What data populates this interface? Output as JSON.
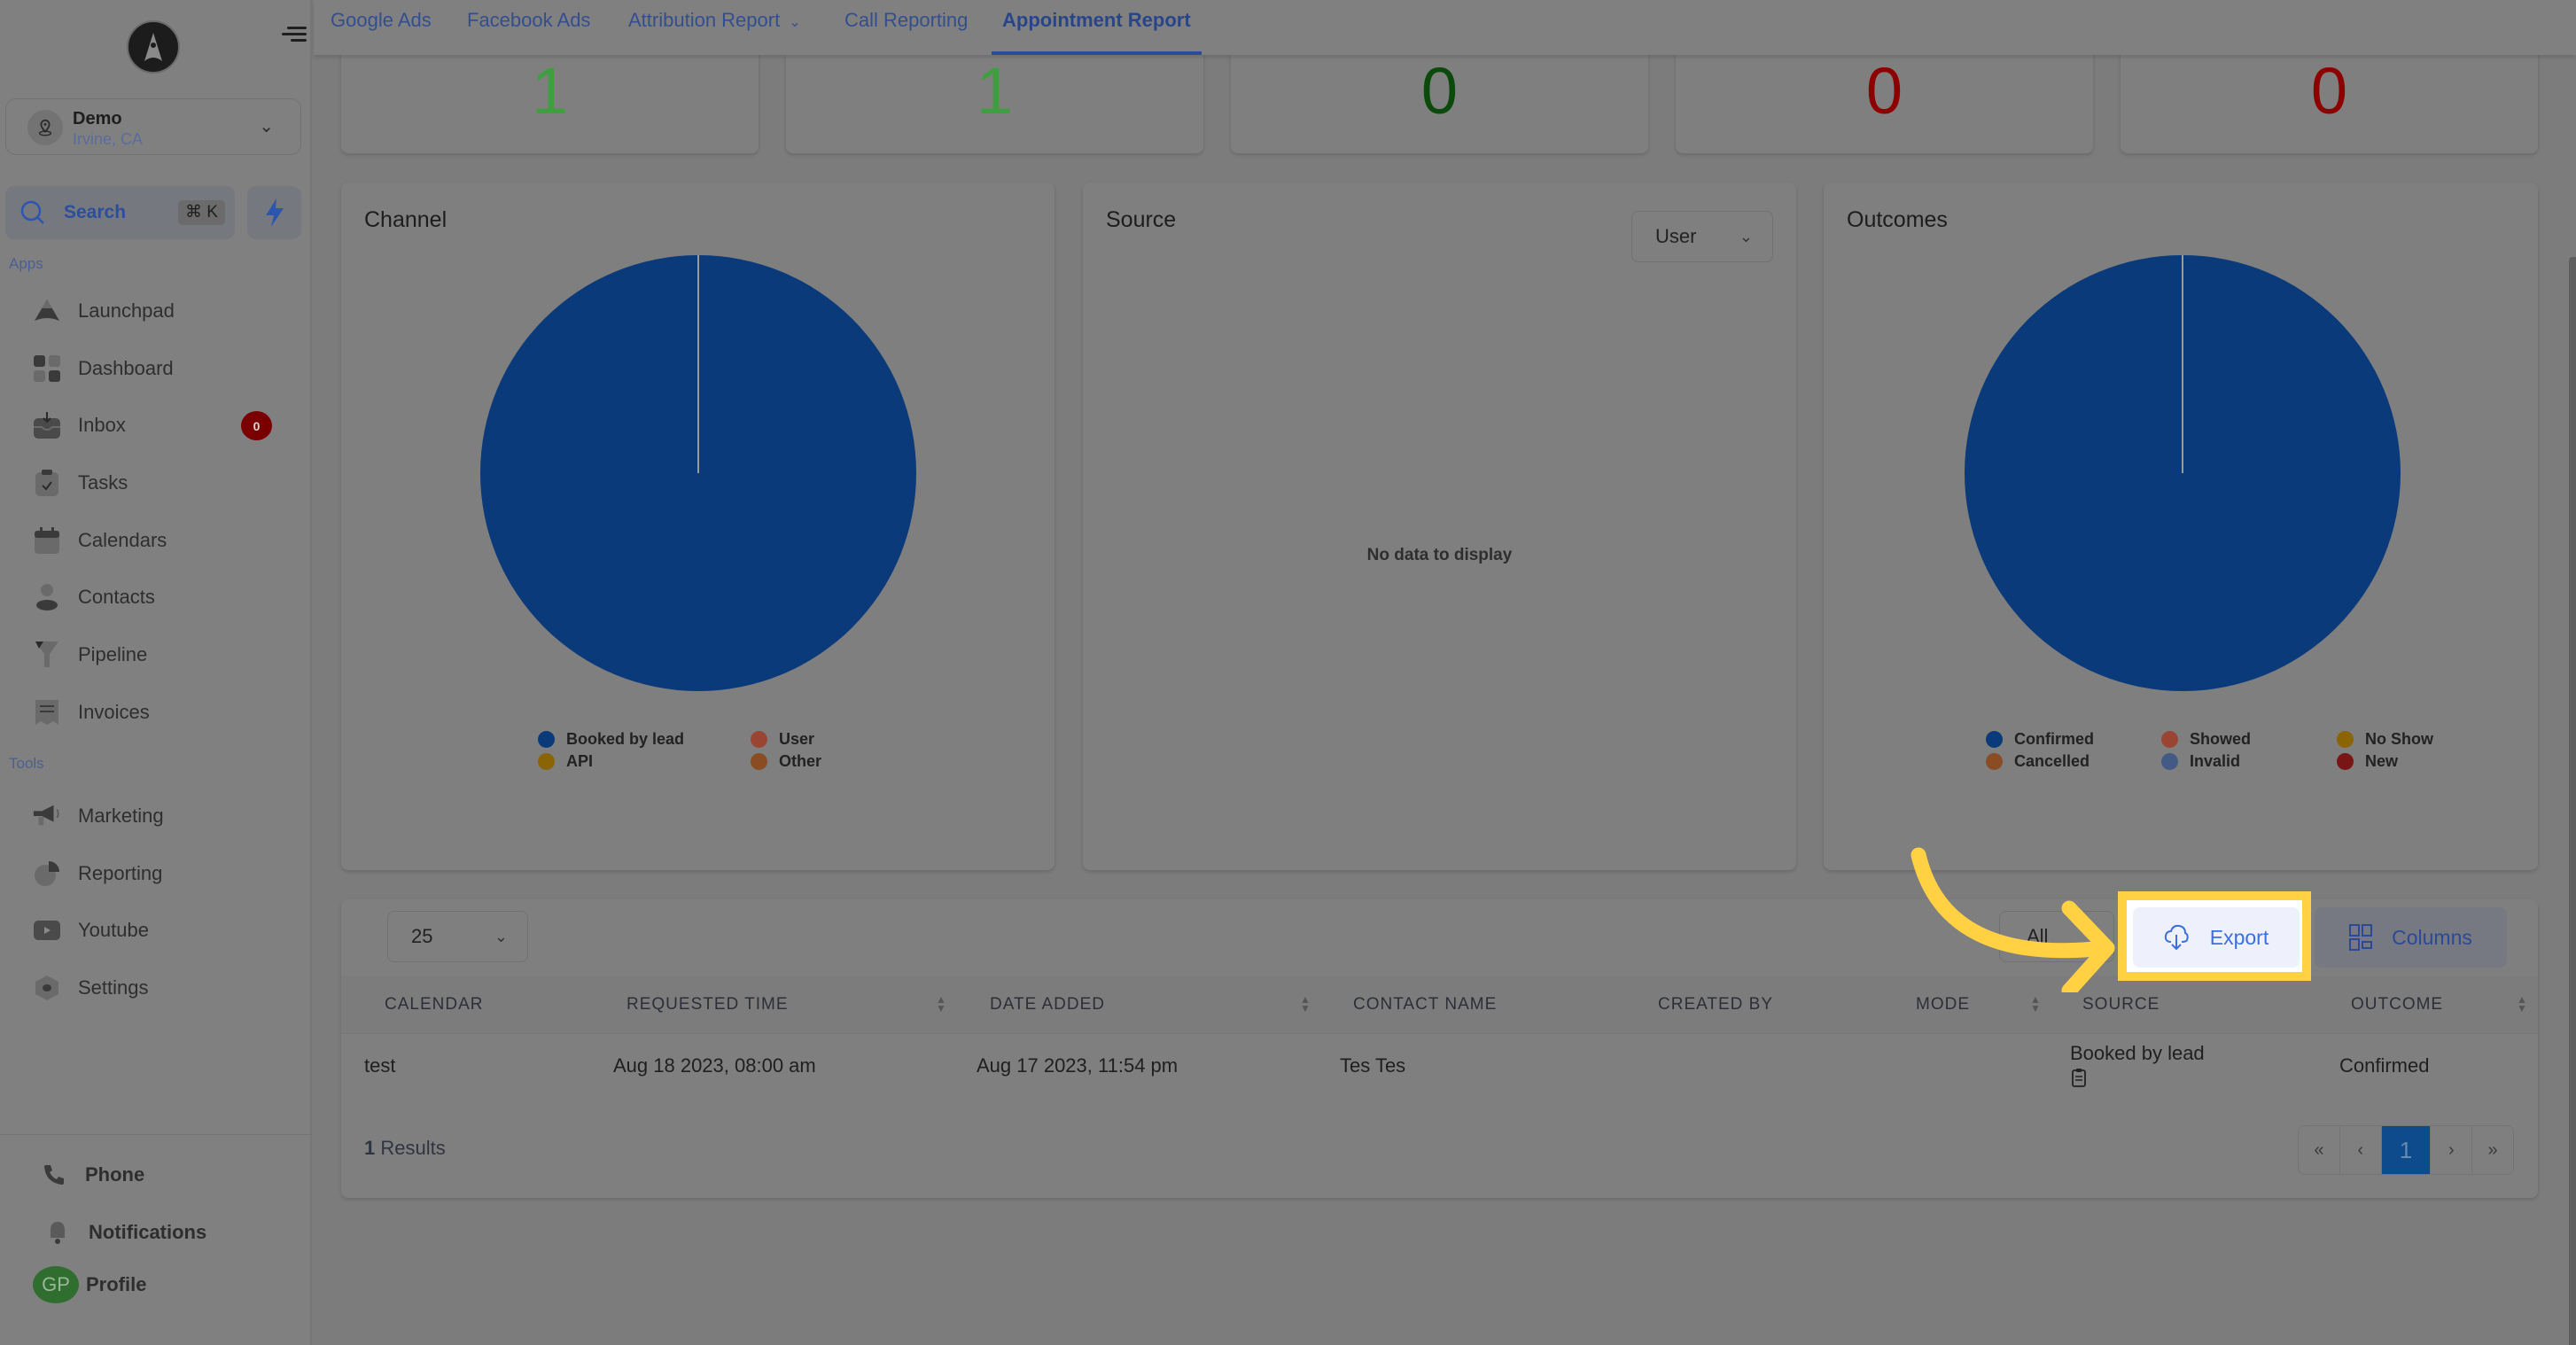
{
  "sidebar": {
    "location": {
      "name": "Demo",
      "city": "Irvine, CA"
    },
    "search": {
      "label": "Search",
      "shortcut": "⌘ K"
    },
    "apps_label": "Apps",
    "apps": [
      {
        "label": "Launchpad",
        "icon": "rocket-icon"
      },
      {
        "label": "Dashboard",
        "icon": "grid-icon"
      },
      {
        "label": "Inbox",
        "icon": "inbox-icon",
        "badge": "0"
      },
      {
        "label": "Tasks",
        "icon": "clipboard-check-icon"
      },
      {
        "label": "Calendars",
        "icon": "calendar-icon"
      },
      {
        "label": "Contacts",
        "icon": "user-icon"
      },
      {
        "label": "Pipeline",
        "icon": "funnel-icon"
      },
      {
        "label": "Invoices",
        "icon": "receipt-icon"
      }
    ],
    "tools_label": "Tools",
    "tools": [
      {
        "label": "Marketing",
        "icon": "megaphone-icon"
      },
      {
        "label": "Reporting",
        "icon": "pie-chart-icon"
      },
      {
        "label": "Youtube",
        "icon": "youtube-icon"
      },
      {
        "label": "Settings",
        "icon": "gear-icon"
      }
    ],
    "bottom": [
      {
        "label": "Phone",
        "icon": "phone-icon"
      },
      {
        "label": "Notifications",
        "icon": "bell-icon"
      },
      {
        "label": "Profile",
        "icon": "avatar",
        "initials": "GP"
      }
    ]
  },
  "topnav": {
    "tabs": [
      {
        "label": "Google Ads"
      },
      {
        "label": "Facebook Ads"
      },
      {
        "label": "Attribution Report",
        "has_dropdown": true
      },
      {
        "label": "Call Reporting"
      },
      {
        "label": "Appointment Report",
        "active": true
      }
    ]
  },
  "stats": [
    {
      "value": "1",
      "color": "#3f9e3f"
    },
    {
      "value": "1",
      "color": "#3f9e3f"
    },
    {
      "value": "0",
      "color": "#0b4a0b"
    },
    {
      "value": "0",
      "color": "#8c0000"
    },
    {
      "value": "0",
      "color": "#8c0000"
    }
  ],
  "panels": {
    "channel": {
      "title": "Channel"
    },
    "source": {
      "title": "Source",
      "select_value": "User",
      "empty_text": "No data to display"
    },
    "outcomes": {
      "title": "Outcomes"
    }
  },
  "chart_data": [
    {
      "type": "pie",
      "title": "Channel",
      "categories": [
        "Booked by lead",
        "User",
        "API",
        "Other"
      ],
      "values": [
        1,
        0,
        0,
        0
      ],
      "colors": [
        "#0a3a7a",
        "#9a4433",
        "#8a6405",
        "#8a4c22"
      ],
      "legend": "bottom"
    },
    {
      "type": "pie",
      "title": "Source",
      "categories": [],
      "values": [],
      "empty_text": "No data to display"
    },
    {
      "type": "pie",
      "title": "Outcomes",
      "categories": [
        "Confirmed",
        "Showed",
        "No Show",
        "Cancelled",
        "Invalid",
        "New"
      ],
      "values": [
        1,
        0,
        0,
        0,
        0,
        0
      ],
      "colors": [
        "#0a3a7a",
        "#9a4433",
        "#8a6405",
        "#8a4c22",
        "#445a86",
        "#7a1515"
      ],
      "legend": "bottom"
    }
  ],
  "table": {
    "page_size": "25",
    "filter_value": "All",
    "export_label": "Export",
    "columns_label": "Columns",
    "headers": [
      {
        "label": "CALENDAR",
        "sortable": false
      },
      {
        "label": "REQUESTED TIME",
        "sortable": true
      },
      {
        "label": "DATE ADDED",
        "sortable": true
      },
      {
        "label": "CONTACT NAME",
        "sortable": false
      },
      {
        "label": "CREATED BY",
        "sortable": false
      },
      {
        "label": "MODE",
        "sortable": true
      },
      {
        "label": "SOURCE",
        "sortable": false
      },
      {
        "label": "OUTCOME",
        "sortable": true
      }
    ],
    "rows": [
      {
        "calendar": "test",
        "requested_time": "Aug 18 2023, 08:00 am",
        "date_added": "Aug 17 2023, 11:54 pm",
        "contact_name": "Tes Tes",
        "created_by": "",
        "mode": "",
        "source": "Booked by lead",
        "outcome": "Confirmed"
      }
    ],
    "results_count": "1",
    "results_label": "Results",
    "pagination": {
      "first": "«",
      "prev": "‹",
      "current": "1",
      "next": "›",
      "last": "»"
    }
  },
  "annotation": {
    "highlight_color": "#ffd143",
    "target": "Export"
  }
}
